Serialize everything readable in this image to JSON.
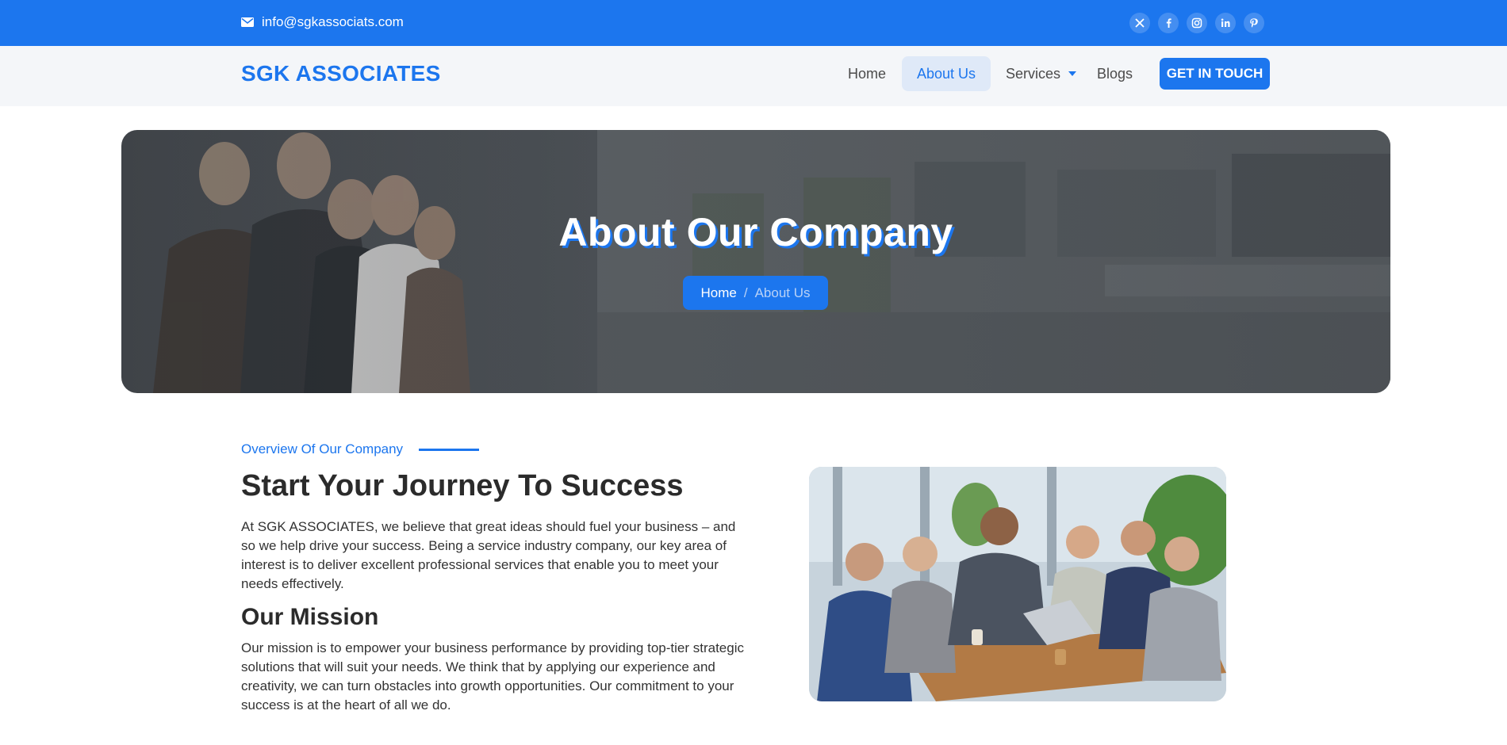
{
  "topbar": {
    "email": "info@sgkassociats.com",
    "email_icon": "envelope-icon",
    "socials": [
      "x-twitter-icon",
      "facebook-icon",
      "instagram-icon",
      "linkedin-icon",
      "pinterest-icon"
    ]
  },
  "nav": {
    "brand": "SGK ASSOCIATES",
    "items": [
      {
        "label": "Home"
      },
      {
        "label": "About Us",
        "active": true
      },
      {
        "label": "Services",
        "has_dropdown": true
      },
      {
        "label": "Blogs"
      }
    ],
    "cta": "GET IN TOUCH"
  },
  "hero": {
    "title": "About Our Company",
    "breadcrumb": {
      "home": "Home",
      "separator": "/",
      "current": "About Us"
    }
  },
  "overview": {
    "eyebrow": "Overview Of Our Company",
    "heading": "Start Your Journey To Success",
    "intro": "At SGK ASSOCIATES, we believe that great ideas should fuel your business – and so we help drive your success. Being a service industry company, our key area of interest is to deliver excellent professional services that enable you to meet your needs effectively.",
    "mission_heading": "Our Mission",
    "mission": "Our mission is to empower your business performance by providing top-tier strategic solutions that will suit your needs. We think that by applying our experience and creativity, we can turn obstacles into growth opportunities. Our commitment to your success is at the heart of all we do."
  },
  "colors": {
    "accent": "#1c76ee",
    "nav_bg": "#f4f6f9",
    "text": "#2b2b2b"
  }
}
